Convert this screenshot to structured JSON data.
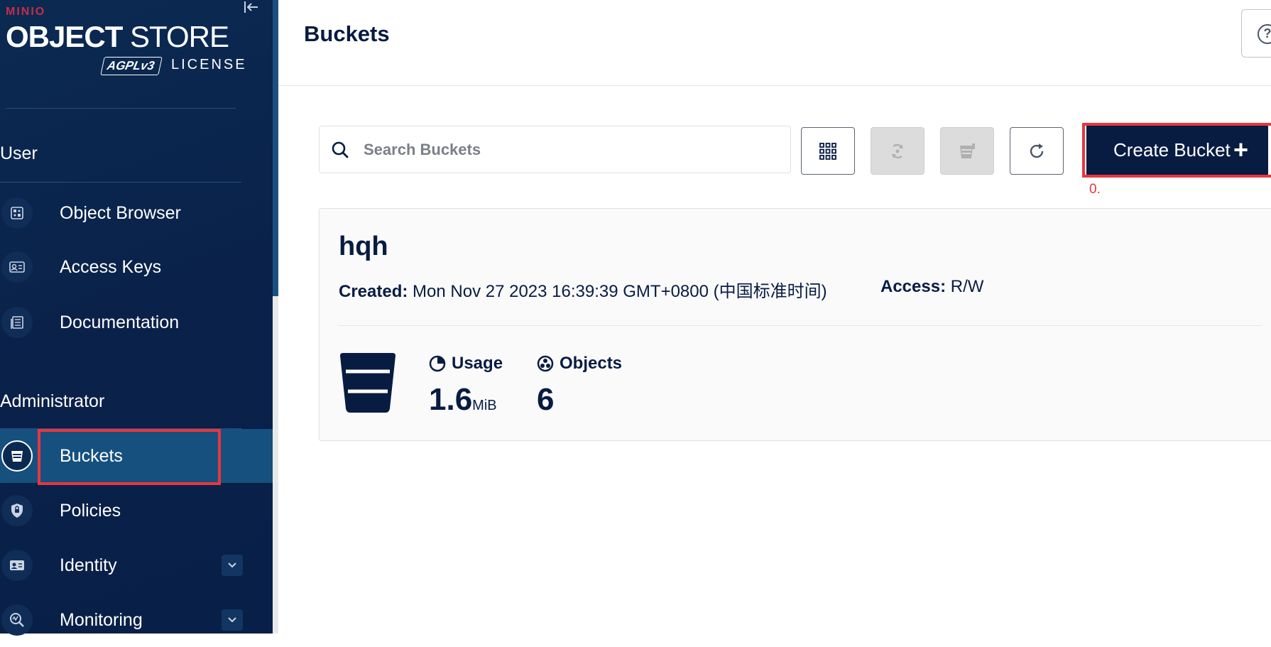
{
  "sidebar": {
    "logo": {
      "brand": "MINIO",
      "product_bold": "OBJECT",
      "product_rest": " STORE",
      "license_badge": "AGPLv3",
      "license_text": "LICENSE"
    },
    "user_section": "User",
    "user_items": [
      {
        "label": "Object Browser",
        "icon": "object-browser-icon"
      },
      {
        "label": "Access Keys",
        "icon": "access-keys-icon"
      },
      {
        "label": "Documentation",
        "icon": "documentation-icon"
      }
    ],
    "admin_section": "Administrator",
    "admin_items": [
      {
        "label": "Buckets",
        "icon": "bucket-icon",
        "active": true
      },
      {
        "label": "Policies",
        "icon": "shield-icon"
      },
      {
        "label": "Identity",
        "icon": "identity-icon",
        "expandable": true
      },
      {
        "label": "Monitoring",
        "icon": "monitoring-icon",
        "expandable": true
      }
    ]
  },
  "header": {
    "title": "Buckets"
  },
  "search": {
    "placeholder": "Search Buckets",
    "value": ""
  },
  "toolbar": {
    "grid_icon": "grid-icon",
    "replication_icon": "replication-icon",
    "lifecycle_icon": "lifecycle-icon",
    "refresh_icon": "refresh-icon",
    "create_label": "Create Bucket",
    "create_icon": "plus-icon",
    "annotation": "0."
  },
  "bucket": {
    "name": "hqh",
    "created_label": "Created:",
    "created_value": " Mon Nov 27 2023 16:39:39 GMT+0800 (中国标准时间)",
    "access_label": "Access:",
    "access_value": " R/W",
    "usage_label": "Usage",
    "usage_value": "1.6",
    "usage_unit": "MiB",
    "objects_label": "Objects",
    "objects_value": "6"
  },
  "colors": {
    "sidebar": "#0a2149",
    "active": "#15507e",
    "primary": "#081c42",
    "highlight": "#e8363d",
    "brand": "#c72c48"
  }
}
